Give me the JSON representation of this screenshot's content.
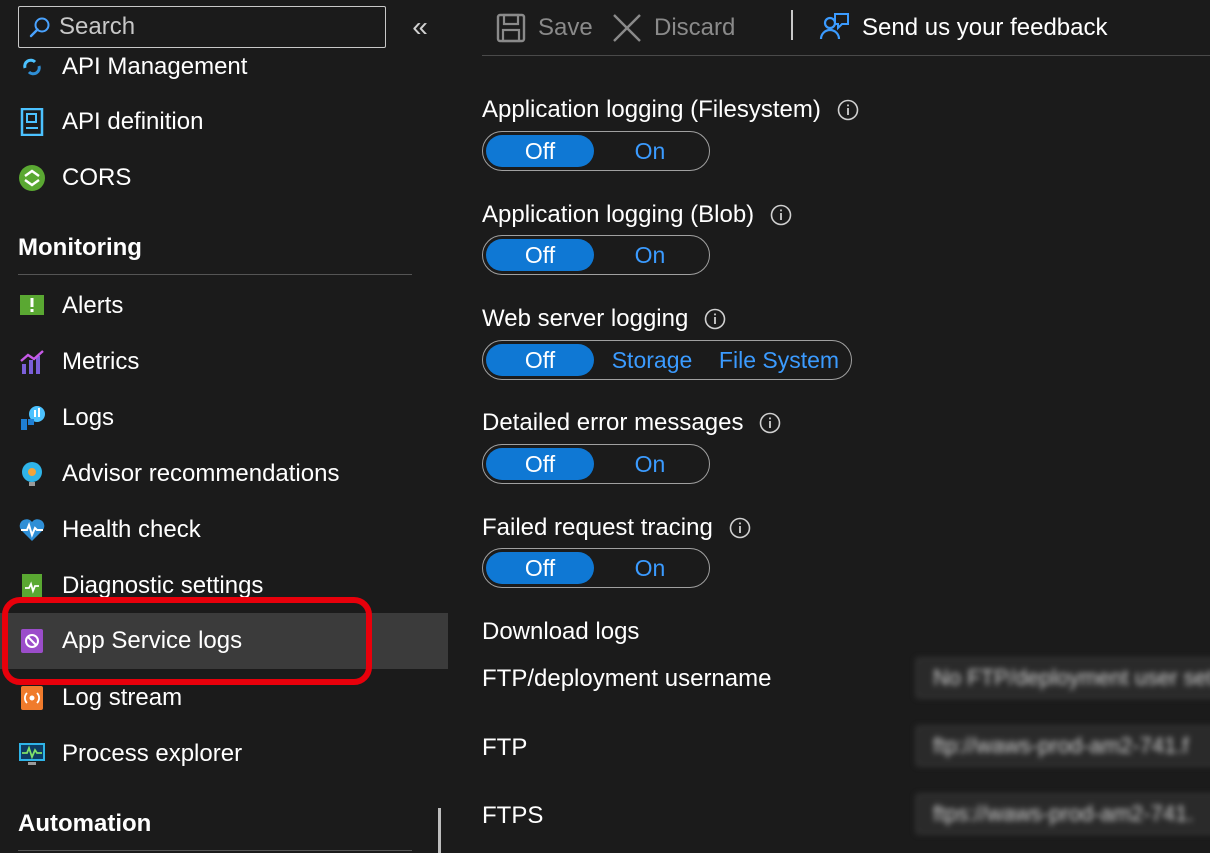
{
  "search": {
    "placeholder": "Search"
  },
  "sidebar": {
    "collapse_glyph": "«",
    "items_top": [
      {
        "label": "API Management",
        "icon": "api-management-icon"
      },
      {
        "label": "API definition",
        "icon": "api-definition-icon"
      },
      {
        "label": "CORS",
        "icon": "cors-icon"
      }
    ],
    "monitoring_heading": "Monitoring",
    "monitoring_items": [
      {
        "label": "Alerts",
        "icon": "alerts-icon"
      },
      {
        "label": "Metrics",
        "icon": "metrics-icon"
      },
      {
        "label": "Logs",
        "icon": "logs-icon"
      },
      {
        "label": "Advisor recommendations",
        "icon": "advisor-icon"
      },
      {
        "label": "Health check",
        "icon": "health-check-icon"
      },
      {
        "label": "Diagnostic settings",
        "icon": "diagnostic-settings-icon"
      },
      {
        "label": "App Service logs",
        "icon": "app-service-logs-icon",
        "selected": true
      },
      {
        "label": "Log stream",
        "icon": "log-stream-icon"
      },
      {
        "label": "Process explorer",
        "icon": "process-explorer-icon"
      }
    ],
    "automation_heading": "Automation"
  },
  "toolbar": {
    "save_label": "Save",
    "discard_label": "Discard",
    "feedback_label": "Send us your feedback"
  },
  "settings": [
    {
      "label": "Application logging (Filesystem)",
      "options": [
        "Off",
        "On"
      ],
      "selected": "Off"
    },
    {
      "label": "Application logging (Blob)",
      "options": [
        "Off",
        "On"
      ],
      "selected": "Off"
    },
    {
      "label": "Web server logging",
      "options": [
        "Off",
        "Storage",
        "File System"
      ],
      "selected": "Off"
    },
    {
      "label": "Detailed error messages",
      "options": [
        "Off",
        "On"
      ],
      "selected": "Off"
    },
    {
      "label": "Failed request tracing",
      "options": [
        "Off",
        "On"
      ],
      "selected": "Off"
    }
  ],
  "download": {
    "heading": "Download logs",
    "username_label": "FTP/deployment username",
    "username_value": "No FTP/deployment user set",
    "ftp_label": "FTP",
    "ftp_value": "ftp://waws-prod-am2-741.f",
    "ftps_label": "FTPS",
    "ftps_value": "ftps://waws-prod-am2-741."
  },
  "colors": {
    "accent": "#0f78d4",
    "link": "#3b9bff",
    "highlight": "#e8000b",
    "selected_bg": "#3b3b3b"
  }
}
